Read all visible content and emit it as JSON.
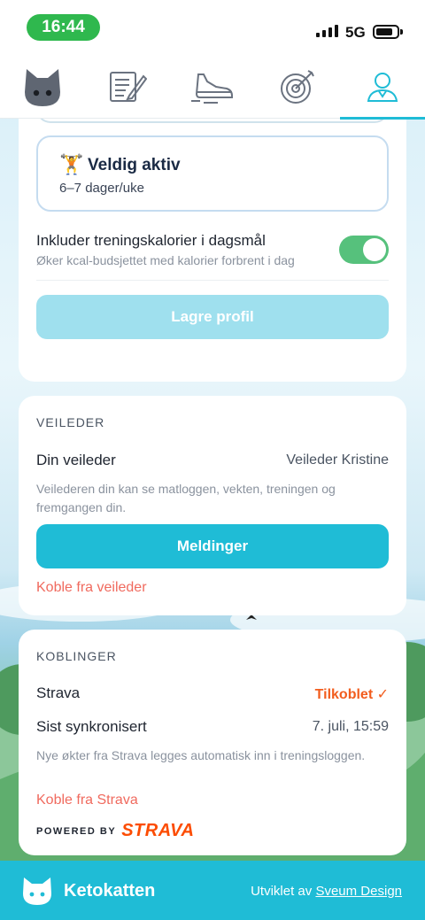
{
  "status_bar": {
    "time": "16:44",
    "network": "5G",
    "time_pill_color": "#2fb84e"
  },
  "tabs": [
    {
      "name": "cat-logo-icon",
      "active": false
    },
    {
      "name": "diary-icon",
      "active": false
    },
    {
      "name": "shoe-icon",
      "active": false
    },
    {
      "name": "target-icon",
      "active": false
    },
    {
      "name": "profile-icon",
      "active": true
    }
  ],
  "profile": {
    "activity_option": {
      "emoji": "🏋️",
      "title": "Veldig aktiv",
      "subtitle": "6–7 dager/uke"
    },
    "exercise_toggle": {
      "title": "Inkluder treningskalorier i dagsmål",
      "subtitle": "Øker kcal-budsjettet med kalorier forbrent i dag",
      "enabled": true
    },
    "save_label": "Lagre profil"
  },
  "coach": {
    "section_title": "VEILEDER",
    "row_label": "Din veileder",
    "row_value": "Veileder Kristine",
    "help": "Veilederen din kan se matloggen, vekten, treningen og fremgangen din.",
    "messages_label": "Meldinger",
    "disconnect_label": "Koble fra veileder"
  },
  "connections": {
    "section_title": "KOBLINGER",
    "strava_label": "Strava",
    "strava_status": "Tilkoblet ✓",
    "last_sync_label": "Sist synkronisert",
    "last_sync_value": "7. juli, 15:59",
    "help": "Nye økter fra Strava legges automatisk inn i treningsloggen.",
    "disconnect_label": "Koble fra Strava",
    "powered_by": "POWERED BY",
    "strava_brand": "STRAVA"
  },
  "footer": {
    "brand": "Ketokatten",
    "credit_prefix": "Utviklet av",
    "credit_link": "Sveum Design"
  },
  "colors": {
    "accent": "#1fbcd6",
    "accent_disabled": "#9fe0ee",
    "toggle_on": "#56c17c",
    "danger": "#f06a5e",
    "strava": "#fc4c02"
  }
}
